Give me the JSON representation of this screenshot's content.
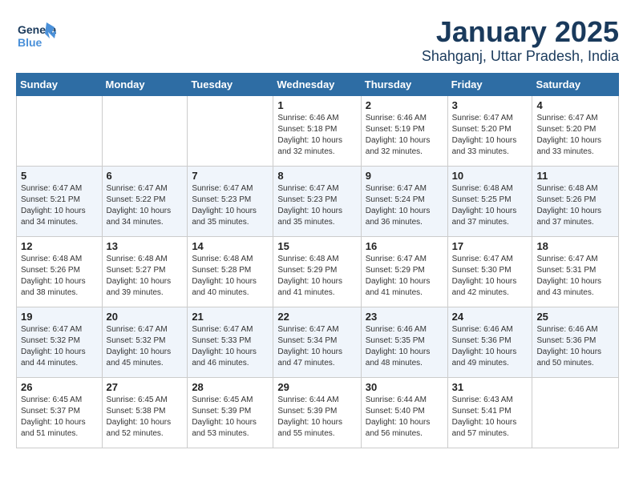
{
  "header": {
    "logo_general": "General",
    "logo_blue": "Blue",
    "month_title": "January 2025",
    "location": "Shahganj, Uttar Pradesh, India"
  },
  "days_of_week": [
    "Sunday",
    "Monday",
    "Tuesday",
    "Wednesday",
    "Thursday",
    "Friday",
    "Saturday"
  ],
  "weeks": [
    [
      {
        "day": "",
        "sunrise": "",
        "sunset": "",
        "daylight": ""
      },
      {
        "day": "",
        "sunrise": "",
        "sunset": "",
        "daylight": ""
      },
      {
        "day": "",
        "sunrise": "",
        "sunset": "",
        "daylight": ""
      },
      {
        "day": "1",
        "sunrise": "Sunrise: 6:46 AM",
        "sunset": "Sunset: 5:18 PM",
        "daylight": "Daylight: 10 hours and 32 minutes."
      },
      {
        "day": "2",
        "sunrise": "Sunrise: 6:46 AM",
        "sunset": "Sunset: 5:19 PM",
        "daylight": "Daylight: 10 hours and 32 minutes."
      },
      {
        "day": "3",
        "sunrise": "Sunrise: 6:47 AM",
        "sunset": "Sunset: 5:20 PM",
        "daylight": "Daylight: 10 hours and 33 minutes."
      },
      {
        "day": "4",
        "sunrise": "Sunrise: 6:47 AM",
        "sunset": "Sunset: 5:20 PM",
        "daylight": "Daylight: 10 hours and 33 minutes."
      }
    ],
    [
      {
        "day": "5",
        "sunrise": "Sunrise: 6:47 AM",
        "sunset": "Sunset: 5:21 PM",
        "daylight": "Daylight: 10 hours and 34 minutes."
      },
      {
        "day": "6",
        "sunrise": "Sunrise: 6:47 AM",
        "sunset": "Sunset: 5:22 PM",
        "daylight": "Daylight: 10 hours and 34 minutes."
      },
      {
        "day": "7",
        "sunrise": "Sunrise: 6:47 AM",
        "sunset": "Sunset: 5:23 PM",
        "daylight": "Daylight: 10 hours and 35 minutes."
      },
      {
        "day": "8",
        "sunrise": "Sunrise: 6:47 AM",
        "sunset": "Sunset: 5:23 PM",
        "daylight": "Daylight: 10 hours and 35 minutes."
      },
      {
        "day": "9",
        "sunrise": "Sunrise: 6:47 AM",
        "sunset": "Sunset: 5:24 PM",
        "daylight": "Daylight: 10 hours and 36 minutes."
      },
      {
        "day": "10",
        "sunrise": "Sunrise: 6:48 AM",
        "sunset": "Sunset: 5:25 PM",
        "daylight": "Daylight: 10 hours and 37 minutes."
      },
      {
        "day": "11",
        "sunrise": "Sunrise: 6:48 AM",
        "sunset": "Sunset: 5:26 PM",
        "daylight": "Daylight: 10 hours and 37 minutes."
      }
    ],
    [
      {
        "day": "12",
        "sunrise": "Sunrise: 6:48 AM",
        "sunset": "Sunset: 5:26 PM",
        "daylight": "Daylight: 10 hours and 38 minutes."
      },
      {
        "day": "13",
        "sunrise": "Sunrise: 6:48 AM",
        "sunset": "Sunset: 5:27 PM",
        "daylight": "Daylight: 10 hours and 39 minutes."
      },
      {
        "day": "14",
        "sunrise": "Sunrise: 6:48 AM",
        "sunset": "Sunset: 5:28 PM",
        "daylight": "Daylight: 10 hours and 40 minutes."
      },
      {
        "day": "15",
        "sunrise": "Sunrise: 6:48 AM",
        "sunset": "Sunset: 5:29 PM",
        "daylight": "Daylight: 10 hours and 41 minutes."
      },
      {
        "day": "16",
        "sunrise": "Sunrise: 6:47 AM",
        "sunset": "Sunset: 5:29 PM",
        "daylight": "Daylight: 10 hours and 41 minutes."
      },
      {
        "day": "17",
        "sunrise": "Sunrise: 6:47 AM",
        "sunset": "Sunset: 5:30 PM",
        "daylight": "Daylight: 10 hours and 42 minutes."
      },
      {
        "day": "18",
        "sunrise": "Sunrise: 6:47 AM",
        "sunset": "Sunset: 5:31 PM",
        "daylight": "Daylight: 10 hours and 43 minutes."
      }
    ],
    [
      {
        "day": "19",
        "sunrise": "Sunrise: 6:47 AM",
        "sunset": "Sunset: 5:32 PM",
        "daylight": "Daylight: 10 hours and 44 minutes."
      },
      {
        "day": "20",
        "sunrise": "Sunrise: 6:47 AM",
        "sunset": "Sunset: 5:32 PM",
        "daylight": "Daylight: 10 hours and 45 minutes."
      },
      {
        "day": "21",
        "sunrise": "Sunrise: 6:47 AM",
        "sunset": "Sunset: 5:33 PM",
        "daylight": "Daylight: 10 hours and 46 minutes."
      },
      {
        "day": "22",
        "sunrise": "Sunrise: 6:47 AM",
        "sunset": "Sunset: 5:34 PM",
        "daylight": "Daylight: 10 hours and 47 minutes."
      },
      {
        "day": "23",
        "sunrise": "Sunrise: 6:46 AM",
        "sunset": "Sunset: 5:35 PM",
        "daylight": "Daylight: 10 hours and 48 minutes."
      },
      {
        "day": "24",
        "sunrise": "Sunrise: 6:46 AM",
        "sunset": "Sunset: 5:36 PM",
        "daylight": "Daylight: 10 hours and 49 minutes."
      },
      {
        "day": "25",
        "sunrise": "Sunrise: 6:46 AM",
        "sunset": "Sunset: 5:36 PM",
        "daylight": "Daylight: 10 hours and 50 minutes."
      }
    ],
    [
      {
        "day": "26",
        "sunrise": "Sunrise: 6:45 AM",
        "sunset": "Sunset: 5:37 PM",
        "daylight": "Daylight: 10 hours and 51 minutes."
      },
      {
        "day": "27",
        "sunrise": "Sunrise: 6:45 AM",
        "sunset": "Sunset: 5:38 PM",
        "daylight": "Daylight: 10 hours and 52 minutes."
      },
      {
        "day": "28",
        "sunrise": "Sunrise: 6:45 AM",
        "sunset": "Sunset: 5:39 PM",
        "daylight": "Daylight: 10 hours and 53 minutes."
      },
      {
        "day": "29",
        "sunrise": "Sunrise: 6:44 AM",
        "sunset": "Sunset: 5:39 PM",
        "daylight": "Daylight: 10 hours and 55 minutes."
      },
      {
        "day": "30",
        "sunrise": "Sunrise: 6:44 AM",
        "sunset": "Sunset: 5:40 PM",
        "daylight": "Daylight: 10 hours and 56 minutes."
      },
      {
        "day": "31",
        "sunrise": "Sunrise: 6:43 AM",
        "sunset": "Sunset: 5:41 PM",
        "daylight": "Daylight: 10 hours and 57 minutes."
      },
      {
        "day": "",
        "sunrise": "",
        "sunset": "",
        "daylight": ""
      }
    ]
  ]
}
